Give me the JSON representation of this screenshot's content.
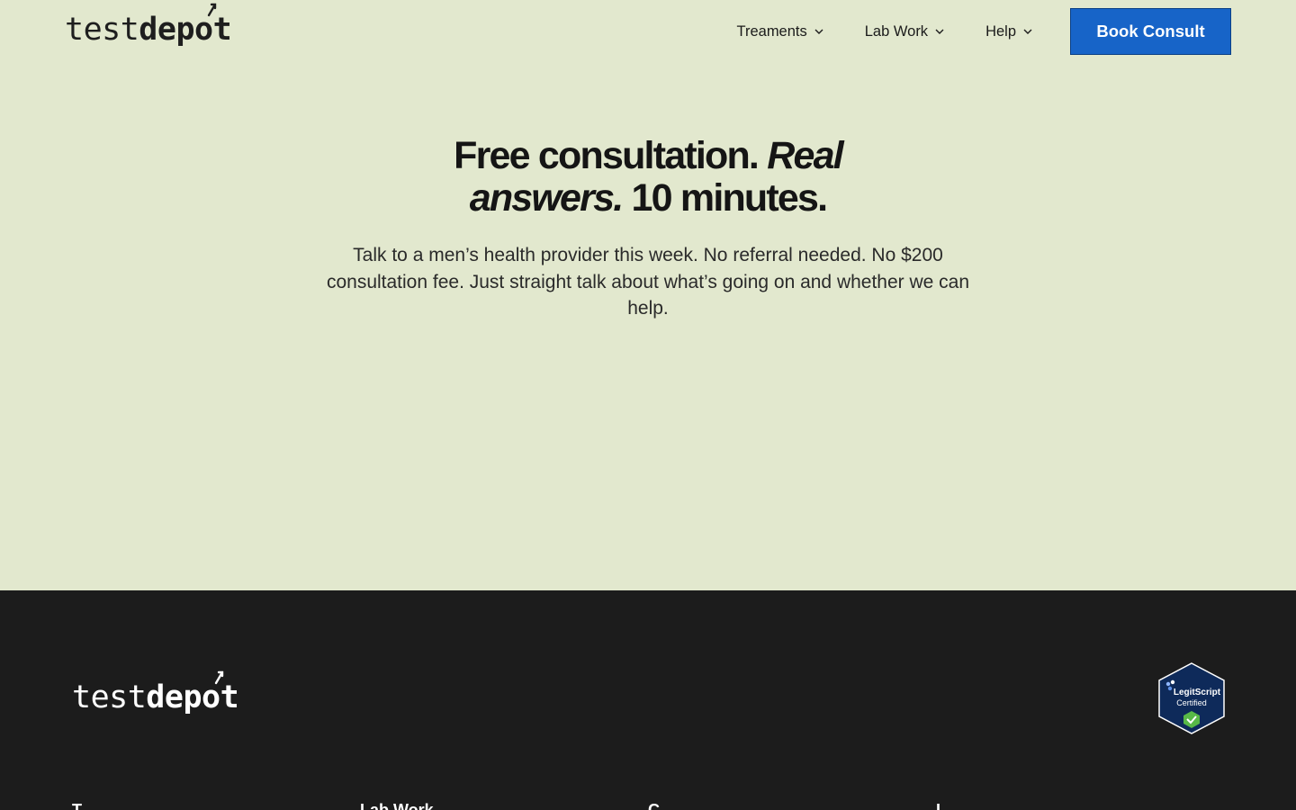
{
  "brand": {
    "logo_prefix": "test",
    "logo_suffix_a": "dep",
    "logo_suffix_o": "o",
    "logo_suffix_b": "t"
  },
  "nav": {
    "items": [
      {
        "label": "Treaments"
      },
      {
        "label": "Lab Work"
      },
      {
        "label": "Help"
      }
    ],
    "cta_label": "Book Consult"
  },
  "hero": {
    "title_part1": "Free consultation. ",
    "title_italic": "Real answers.",
    "title_part2": " 10 minutes.",
    "subtitle": "Talk to a men’s health provider this week. No referral needed. No $200 consultation fee. Just straight talk about what’s going on and whether we can help."
  },
  "footer": {
    "badge_line1": "LegitScript",
    "badge_line2": "Certified",
    "columns": [
      "T",
      "Lab Work",
      "C",
      "L"
    ]
  },
  "colors": {
    "page_bg": "#e2e8ce",
    "accent": "#1764c8",
    "footer_bg": "#1c1c1c",
    "badge_bg": "#0e2a5a",
    "badge_check": "#58b947"
  },
  "icons": [
    "chevron-down-icon",
    "male-symbol-icon",
    "legitscript-badge-icon",
    "check-shield-icon"
  ]
}
